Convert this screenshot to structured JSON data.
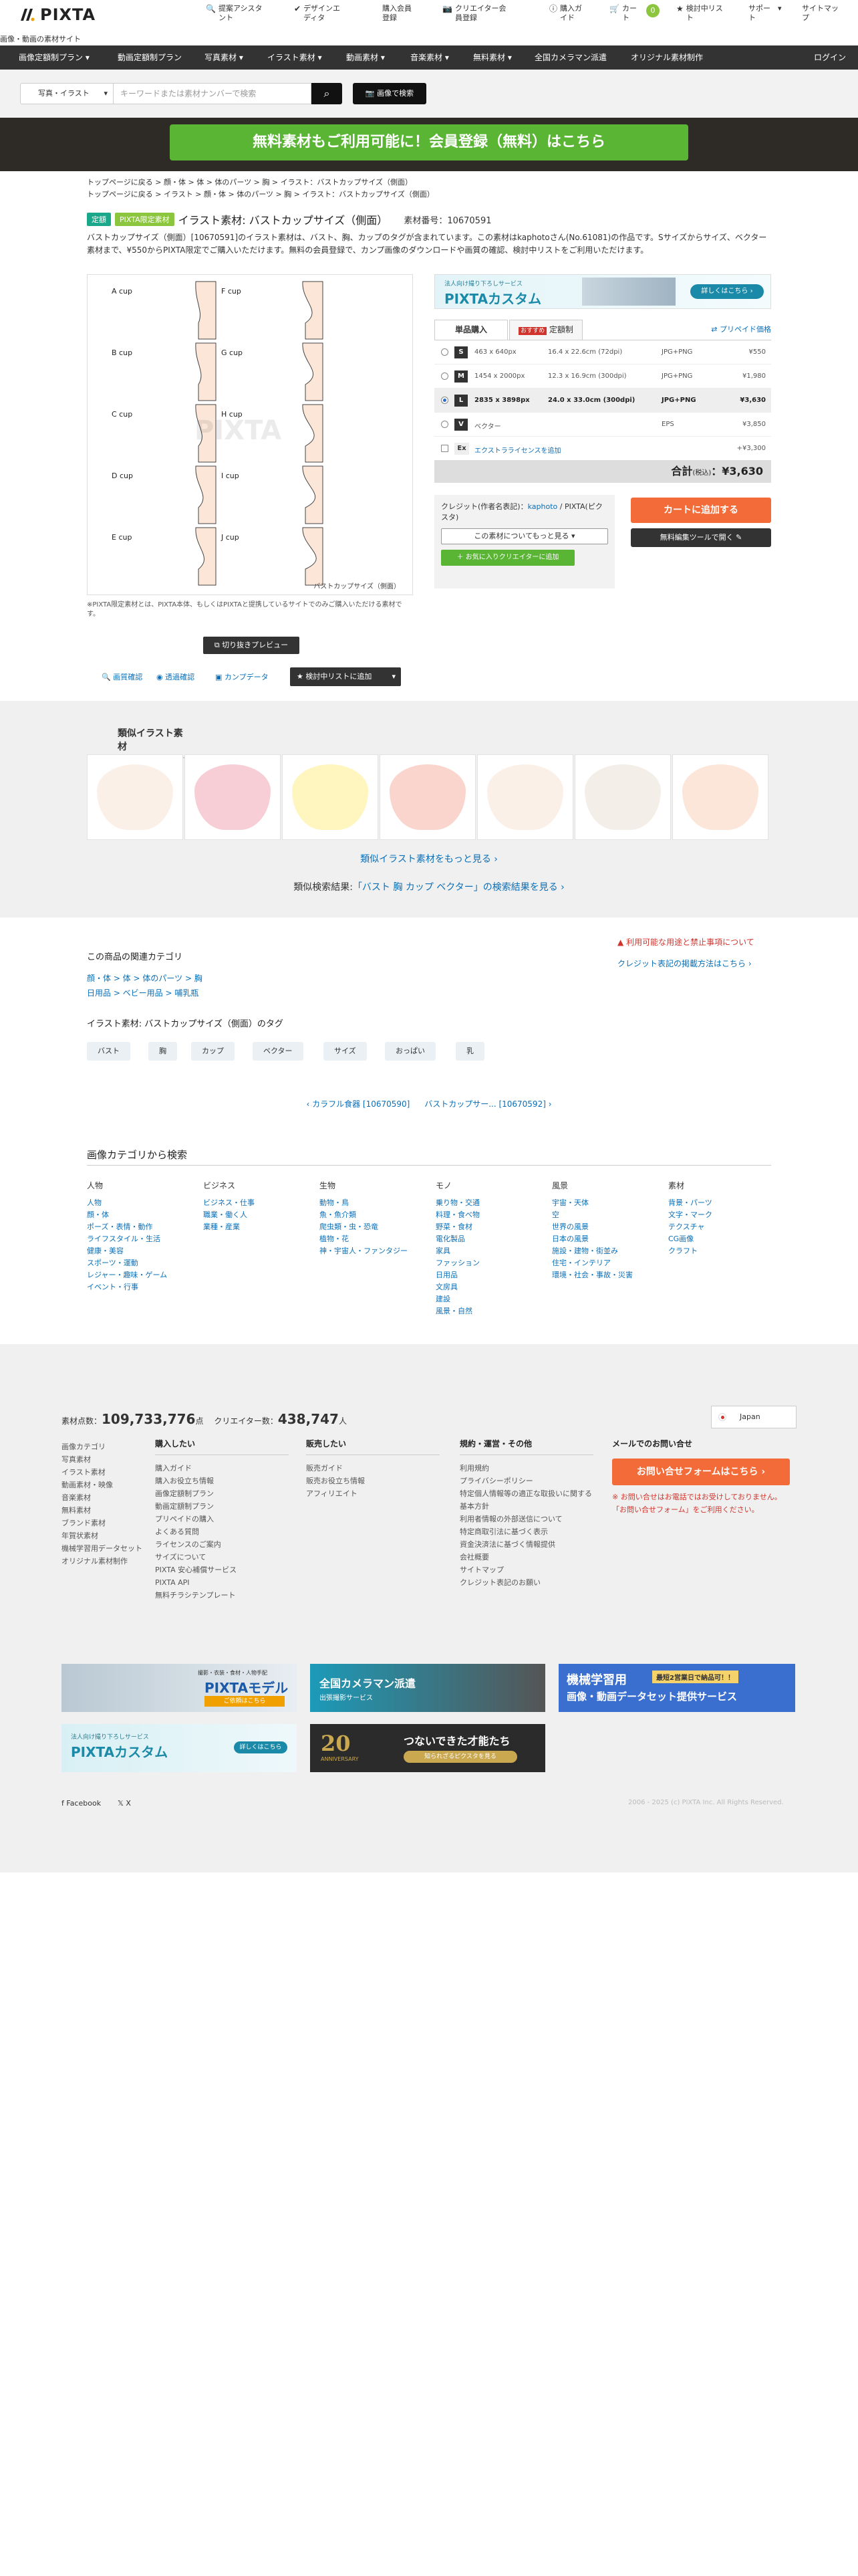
{
  "header": {
    "brand": "PIXTA",
    "tagline": "画像・動画の素材サイト",
    "nav": [
      {
        "icon": "search-icon",
        "label": "提案アシスタント"
      },
      {
        "icon": "check-icon",
        "label": "デザインエディタ"
      },
      {
        "icon": "",
        "label": "購入会員登録"
      },
      {
        "icon": "camera-icon",
        "label": "クリエイター会員登録"
      },
      {
        "icon": "",
        "label": "購入ガイド"
      },
      {
        "icon": "cart-icon",
        "label": "カート"
      },
      {
        "icon": "",
        "label": "0"
      },
      {
        "icon": "star-icon",
        "label": "検討中リスト"
      },
      {
        "icon": "",
        "label": "サポート"
      },
      {
        "icon": "",
        "label": "サイトマップ"
      }
    ]
  },
  "categories": [
    "画像定額制プラン",
    "動画定額制プラン",
    "写真素材",
    "イラスト素材",
    "動画素材",
    "音楽素材",
    "無料素材",
    "全国カメラマン派遣",
    "オリジナル素材制作"
  ],
  "login": "ログイン",
  "search": {
    "type": "写真・イラスト",
    "placeholder": "キーワードまたは素材ナンバーで検索",
    "image_search": "画像で検索"
  },
  "banner": "無料素材もご利用可能に！会員登録（無料）はこちら",
  "breadcrumbs": [
    "トップページに戻る > 顔・体 > 体 > 体のパーツ > 胸 > イラスト：バストカップサイズ（側面）",
    "トップページに戻る > イラスト > 顔・体 > 体のパーツ > 胸 > イラスト：バストカップサイズ（側面）"
  ],
  "product": {
    "badge1": "定額",
    "badge2": "PIXTA限定素材",
    "title": "イラスト素材: バストカップサイズ（側面）",
    "number": "素材番号：10670591",
    "description": "バストカップサイズ（側面）[10670591]のイラスト素材は、バスト、胸、カップのタグが含まれています。この素材はkaphotoさん(No.61081)の作品です。Sサイズからサイズ、ベクター素材まで、¥550からPIXTA限定でご購入いただけます。無料の会員登録で、カンプ画像のダウンロードや画質の確認、検討中リストをご利用いただけます。",
    "preview_caption": "バストカップサイズ（側面）",
    "watermark": "PIXTA",
    "cups": [
      "A cup",
      "B cup",
      "C cup",
      "D cup",
      "E cup",
      "F cup",
      "G cup",
      "H cup",
      "I cup",
      "J cup"
    ],
    "note": "※PIXTA限定素材とは、PIXTA本体、もしくはPIXTAと提携しているサイトでのみご購入いただける素材です。",
    "crop_button": "切り抜きプレビュー",
    "tools": [
      "画質確認",
      "透過確認",
      "カンプデータ"
    ],
    "add_list": "検討中リストに追加"
  },
  "purchase": {
    "ad_small": "法人向け撮り下ろしサービス",
    "ad_title": "PIXTAカスタム",
    "ad_button": "詳しくはこちら",
    "tab1": "単品購入",
    "tab2_badge": "おすすめ",
    "tab2": "定額制",
    "private": "プリペイド価格",
    "sizes": [
      {
        "code": "S",
        "px": "463 x 640px",
        "cm": "16.4 x 22.6cm (72dpi)",
        "fmt": "JPG+PNG",
        "price": "¥550"
      },
      {
        "code": "M",
        "px": "1454 x 2000px",
        "cm": "12.3 x 16.9cm (300dpi)",
        "fmt": "JPG+PNG",
        "price": "¥1,980"
      },
      {
        "code": "L",
        "px": "2835 x 3898px",
        "cm": "24.0 x 33.0cm (300dpi)",
        "fmt": "JPG+PNG",
        "price": "¥3,630"
      },
      {
        "code": "V",
        "px": "ベクター",
        "cm": "",
        "fmt": "EPS",
        "price": "¥3,850"
      },
      {
        "code": "Ex",
        "px": "エクストラライセンスを追加",
        "cm": "",
        "fmt": "",
        "price": "+¥3,300"
      }
    ],
    "total_label": "合計",
    "total_tax": "(税込)",
    "total": "：¥3,630",
    "credit_label": "クレジット(作者名表記)：",
    "credit_name": "kaphoto",
    "credit_site": " / PIXTA(ピクスタ)",
    "more_by": "この素材についてもっと見る",
    "favorite": "お気に入りクリエイターに追加",
    "cart": "カートに追加する",
    "editor": "無料編集ツールで開く"
  },
  "similar": {
    "title": "類似イラスト素材",
    "more": "類似イラスト素材をもっと見る ›",
    "result_prefix": "類似検索結果:",
    "result_link": "「バスト 胸 カップ ベクター」の検索結果を見る ›"
  },
  "related": {
    "usage": "利用可能な用途と禁止事項について",
    "credit_note": "クレジット表記の掲載方法はこちら ›",
    "title": "この商品の関連カテゴリ",
    "cat1": "顔・体 > 体 > 体のパーツ > 胸",
    "cat2": "日用品 > ベビー用品 > 哺乳瓶",
    "tags_title": "イラスト素材: バストカップサイズ（側面）のタグ",
    "tags": [
      "バスト",
      "胸",
      "カップ",
      "ベクター",
      "サイズ",
      "おっぱい",
      "乳"
    ],
    "prev": "‹ カラフル食器 [10670590]",
    "next": "バストカップサー... [10670592] ›"
  },
  "category_search": {
    "title": "画像カテゴリから検索",
    "columns": [
      {
        "head": "人物",
        "items": [
          "人物",
          "顔・体",
          "ポーズ・表情・動作",
          "ライフスタイル・生活",
          "健康・美容",
          "スポーツ・運動",
          "レジャー・趣味・ゲーム",
          "イベント・行事"
        ]
      },
      {
        "head": "ビジネス",
        "items": [
          "ビジネス・仕事",
          "職業・働く人",
          "業種・産業"
        ]
      },
      {
        "head": "生物",
        "items": [
          "動物・鳥",
          "魚・魚介類",
          "爬虫類・虫・恐竜",
          "植物・花",
          "神・宇宙人・ファンタジー"
        ]
      },
      {
        "head": "モノ",
        "items": [
          "乗り物・交通",
          "料理・食べ物",
          "野菜・食材",
          "電化製品",
          "家具",
          "ファッション",
          "日用品",
          "文房具",
          "建設",
          "風景・自然"
        ]
      },
      {
        "head": "風景",
        "items": [
          "宇宙・天体",
          "空",
          "世界の風景",
          "日本の風景",
          "施設・建物・街並み",
          "住宅・インテリア",
          "環境・社会・事故・災害"
        ]
      },
      {
        "head": "素材",
        "items": [
          "背景・パーツ",
          "文字・マーク",
          "テクスチャ",
          "CG画像",
          "クラフト"
        ]
      }
    ]
  },
  "footer": {
    "count_label": "素材点数：",
    "count": "109,733,776",
    "count_unit": "点",
    "creator_label": "クリエイター数：",
    "creator": "438,747",
    "creator_unit": "人",
    "country": "Japan",
    "col0": [
      "画像カテゴリ",
      "写真素材",
      "イラスト素材",
      "動画素材・映像",
      "音楽素材",
      "無料素材",
      "ブランド素材",
      "年賀状素材",
      "機械学習用データセット",
      "オリジナル素材制作"
    ],
    "col1_head": "購入したい",
    "col1": [
      "購入ガイド",
      "購入お役立ち情報",
      "画像定額制プラン",
      "動画定額制プラン",
      "プリペイドの購入",
      "よくある質問",
      "ライセンスのご案内",
      "サイズについて",
      "PIXTA 安心補償サービス",
      "PIXTA API",
      "無料チラシテンプレート"
    ],
    "col2_head": "販売したい",
    "col2": [
      "販売ガイド",
      "販売お役立ち情報",
      "アフィリエイト"
    ],
    "col3_head": "規約・運営・その他",
    "col3": [
      "利用規約",
      "プライバシーポリシー",
      "特定個人情報等の適正な取扱いに関する基本方針",
      "利用者情報の外部送信について",
      "特定商取引法に基づく表示",
      "資金決済法に基づく情報提供",
      "会社概要",
      "サイトマップ",
      "クレジット表記のお願い"
    ],
    "contact_head": "メールでのお問い合せ",
    "contact_btn": "お問い合せフォームはこちら ›",
    "contact_note1": "※ お問い合せはお電話ではお受けしておりません。",
    "contact_note2": "「お問い合せフォーム」をご利用ください。",
    "b1_small": "撮影・衣装・食材・人物手配",
    "b1": "PIXTAモデル",
    "b1_btn": "ご依頼はこちら",
    "b2": "全国カメラマン派遣",
    "b2_small": "出張撮影サービス",
    "b3": "機械学習用",
    "b3_sub": "画像・動画データセット提供サービス",
    "b3_badge": "最短2営業日で納品可！！",
    "b4_small": "法人向け撮り下ろしサービス",
    "b4": "PIXTAカスタム",
    "b4_btn": "詳しくはこちら",
    "b5_num": "20",
    "b5_sub": "ANNIVERSARY",
    "b5": "つないできた才能たち",
    "b5_btn": "知られざるピクスタを見る",
    "fb": "Facebook",
    "x": "X",
    "copyright": "2006 - 2025 (c) PIXTA Inc. All Rights Reserved."
  },
  "colors": {
    "accent": "#5ab534",
    "cart": "#f26b38",
    "link": "#0a6fb8",
    "dark": "#333333"
  }
}
